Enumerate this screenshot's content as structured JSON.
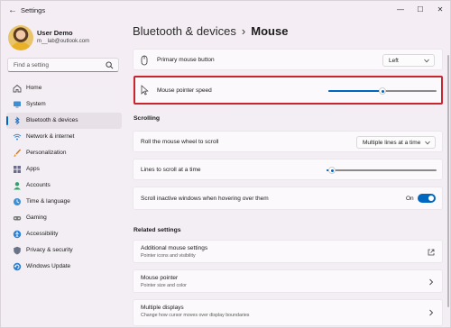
{
  "window": {
    "title": "Settings",
    "minimize": "—",
    "maximize": "☐",
    "close": "✕"
  },
  "profile": {
    "name": "User Demo",
    "email": "m__lab@outlook.com"
  },
  "search": {
    "placeholder": "Find a setting"
  },
  "sidebar": {
    "items": [
      {
        "label": "Home",
        "icon": "home-icon"
      },
      {
        "label": "System",
        "icon": "monitor-icon"
      },
      {
        "label": "Bluetooth & devices",
        "icon": "bluetooth-icon",
        "active": true
      },
      {
        "label": "Network & internet",
        "icon": "wifi-icon"
      },
      {
        "label": "Personalization",
        "icon": "brush-icon"
      },
      {
        "label": "Apps",
        "icon": "apps-icon"
      },
      {
        "label": "Accounts",
        "icon": "person-icon"
      },
      {
        "label": "Time & language",
        "icon": "clock-globe-icon"
      },
      {
        "label": "Gaming",
        "icon": "gamepad-icon"
      },
      {
        "label": "Accessibility",
        "icon": "accessibility-icon"
      },
      {
        "label": "Privacy & security",
        "icon": "shield-icon"
      },
      {
        "label": "Windows Update",
        "icon": "update-icon"
      }
    ]
  },
  "breadcrumb": {
    "parent": "Bluetooth & devices",
    "separator": "›",
    "current": "Mouse"
  },
  "main": {
    "primary_button": {
      "label": "Primary mouse button",
      "value": "Left"
    },
    "pointer_speed": {
      "label": "Mouse pointer speed",
      "value_fraction": 0.5
    },
    "scrolling_title": "Scrolling",
    "roll_wheel": {
      "label": "Roll the mouse wheel to scroll",
      "value": "Multiple lines at a time"
    },
    "lines_to_scroll": {
      "label": "Lines to scroll at a time",
      "value_fraction": 0.05
    },
    "inactive_scroll": {
      "label": "Scroll inactive windows when hovering over them",
      "state": "On"
    },
    "related_title": "Related settings",
    "related": [
      {
        "title": "Additional mouse settings",
        "subtitle": "Pointer icons and visibility"
      },
      {
        "title": "Mouse pointer",
        "subtitle": "Pointer size and color"
      },
      {
        "title": "Multiple displays",
        "subtitle": "Change how cursor moves over display boundaries"
      }
    ]
  },
  "colors": {
    "accent": "#0067c0",
    "highlight_box": "#c8252f"
  }
}
